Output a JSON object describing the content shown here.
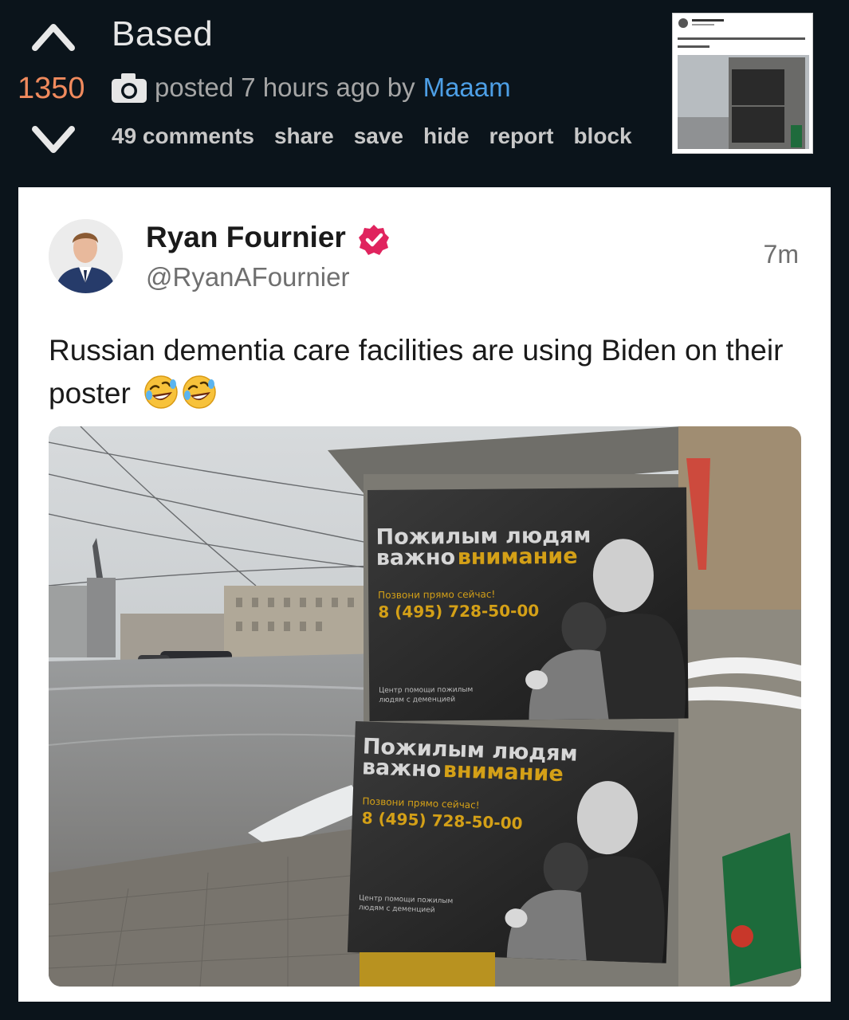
{
  "post": {
    "score": "1350",
    "title": "Based",
    "meta_prefix": "posted 7 hours ago by",
    "author": "Maaam",
    "actions": [
      "49 comments",
      "share",
      "save",
      "hide",
      "report",
      "block"
    ]
  },
  "tweet": {
    "name": "Ryan Fournier",
    "handle": "@RyanAFournier",
    "time": "7m",
    "text": "Russian dementia care facilities are using Biden on their poster"
  },
  "poster": {
    "headline_line1": "Пожилым людям",
    "headline_line2_prefix": "важно",
    "headline_line2_accent": "внимание",
    "call_label": "Позвони прямо сейчас!",
    "phone": "8 (495) 728-50-00",
    "footer_line1": "Центр помощи пожилым",
    "footer_line2": "людям с деменцией"
  },
  "icons": {
    "upvote": "chevron-up-icon",
    "downvote": "chevron-down-icon",
    "camera": "camera-icon",
    "verified": "verified-badge-icon",
    "emoji": "rolling-laughing-emoji"
  },
  "colors": {
    "score": "#f08a5d",
    "link": "#4d9fe6",
    "verified": "#e0245e",
    "poster_accent": "#d4a017"
  }
}
